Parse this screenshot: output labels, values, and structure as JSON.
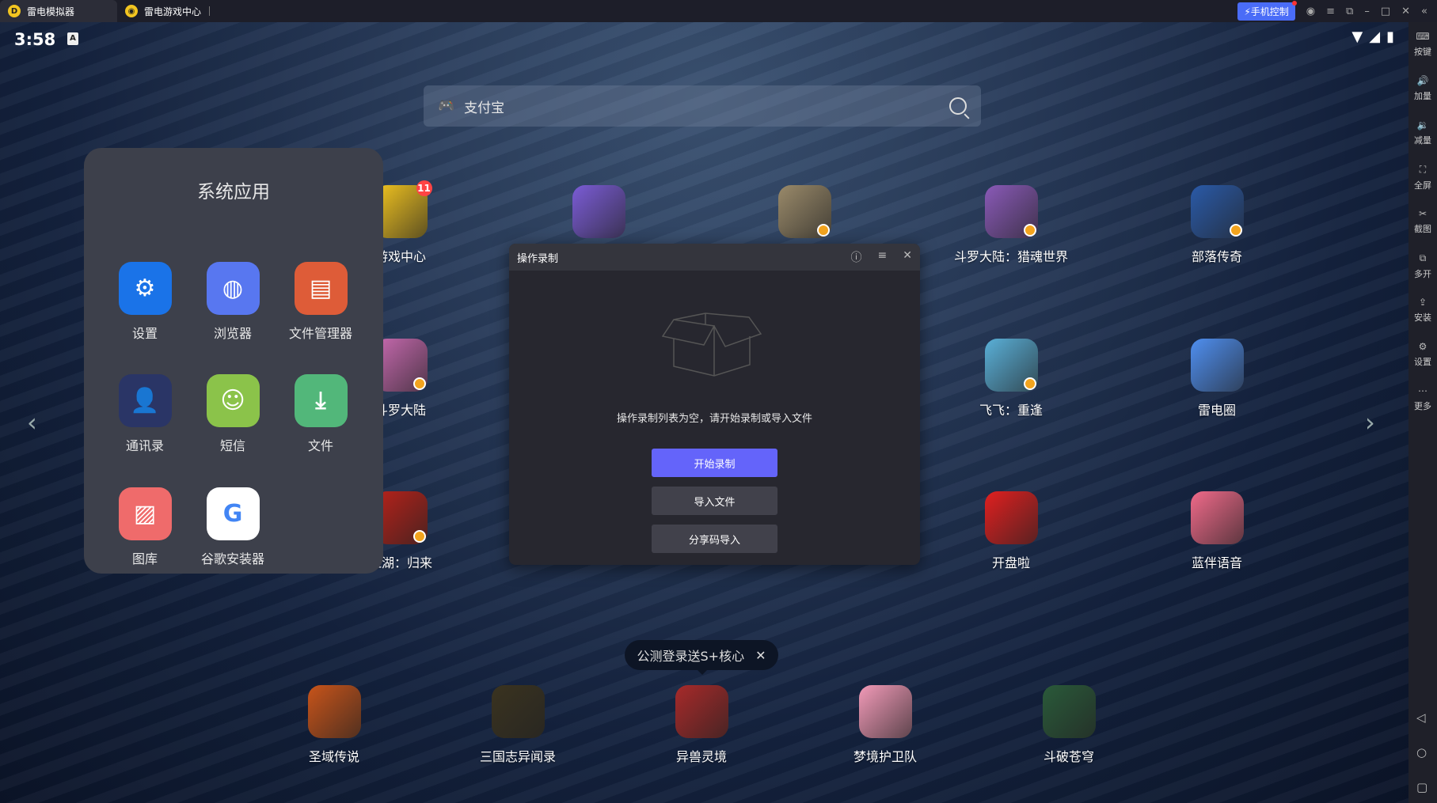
{
  "titlebar": {
    "tabs": [
      {
        "label": "雷电模拟器",
        "active": true
      },
      {
        "label": "雷电游戏中心",
        "active": false
      }
    ],
    "phone_control": "手机控制"
  },
  "status": {
    "time": "3:58"
  },
  "search": {
    "value": "支付宝"
  },
  "folder": {
    "title": "系统应用",
    "apps": [
      {
        "label": "设置",
        "color": "#1a73e8",
        "glyph": "⚙"
      },
      {
        "label": "浏览器",
        "color": "#5877f0",
        "glyph": "◍"
      },
      {
        "label": "文件管理器",
        "color": "#de5c38",
        "glyph": "▤"
      },
      {
        "label": "通讯录",
        "color": "#2a3566",
        "glyph": "👤"
      },
      {
        "label": "短信",
        "color": "#8bc34a",
        "glyph": "☺"
      },
      {
        "label": "文件",
        "color": "#52b77a",
        "glyph": "⤓"
      },
      {
        "label": "图库",
        "color": "#ef6b6b",
        "glyph": "▨"
      },
      {
        "label": "谷歌安装器",
        "color": "#ffffff",
        "glyph": "G"
      }
    ]
  },
  "desktop": [
    {
      "label": "游戏中心",
      "badge": "11",
      "color": "#f3c520"
    },
    {
      "label": "",
      "color": "#7b5cd6"
    },
    {
      "label": "",
      "color": "#9a8a6a"
    },
    {
      "label": "斗罗大陆：猎魂世界",
      "color": "#8a5ab8"
    },
    {
      "label": "部落传奇",
      "color": "#2a5aa8"
    },
    {
      "label": "斗罗大陆",
      "color": "#c86ab0"
    },
    {
      "label": "飞飞：重逢",
      "color": "#5ab0d8"
    },
    {
      "label": "雷电圈",
      "color": "#4f8ff0"
    },
    {
      "label": "江湖：归来",
      "color": "#b8221a"
    },
    {
      "label": "开盘啦",
      "color": "#e02020"
    },
    {
      "label": "蓝伴语音",
      "color": "#f06a8a"
    }
  ],
  "dock": [
    {
      "label": "圣域传说",
      "color": "#c8541a"
    },
    {
      "label": "三国志异闻录",
      "color": "#3a3320"
    },
    {
      "label": "异兽灵境",
      "color": "#a82a2a"
    },
    {
      "label": "梦境护卫队",
      "color": "#f29ab8"
    },
    {
      "label": "斗破苍穹",
      "color": "#2a5a3a"
    }
  ],
  "promo": {
    "text": "公测登录送S+核心"
  },
  "dialog": {
    "title": "操作录制",
    "empty_text": "操作录制列表为空，请开始录制或导入文件",
    "start": "开始录制",
    "import": "导入文件",
    "share": "分享码导入",
    "accent": "#6464fa"
  },
  "sidebar": [
    "按键",
    "加量",
    "减量",
    "全屏",
    "截图",
    "多开",
    "安装",
    "设置",
    "更多"
  ]
}
